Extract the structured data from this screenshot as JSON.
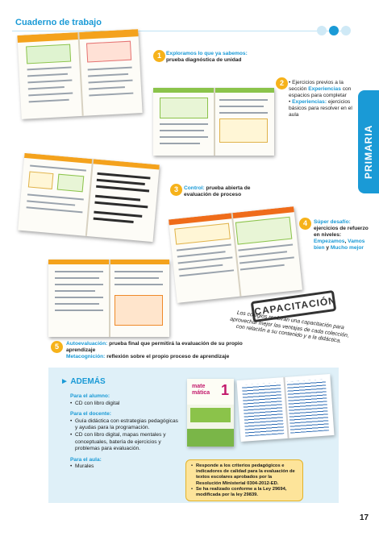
{
  "header": {
    "title": "Cuaderno de trabajo"
  },
  "side_tab": {
    "label": "PRIMARIA"
  },
  "colors": {
    "accent": "#1a9ad6",
    "number_badge": "#f6b21a"
  },
  "features": [
    {
      "number": "1",
      "label": "Exploramos lo que ya sabemos:",
      "text": "prueba diagnóstica de unidad"
    },
    {
      "number": "2",
      "items": [
        {
          "pre": "Ejercicios previos a la sección ",
          "highlight": "Experiencias",
          "post": " con espacios para completar"
        },
        {
          "pre": "",
          "highlight": "Experiencias:",
          "post": " ejercicios básicos para resolver en el aula"
        }
      ]
    },
    {
      "number": "3",
      "label": "Control:",
      "text": " prueba abierta de evaluación de proceso"
    },
    {
      "number": "4",
      "label": "Súper desafío:",
      "text": " ejercicios de refuerzo en niveles:",
      "levels": [
        "Empezamos",
        "Vamos bien",
        "Mucho mejor"
      ],
      "sep1": ", ",
      "sep2": " y "
    },
    {
      "number": "5",
      "line1_label": "Autoevaluación:",
      "line1_text": " prueba final que permitirá la evaluación de su propio aprendizaje",
      "line2_label": "Metacognición:",
      "line2_text": " reflexión sobre el propio proceso de aprendizaje"
    }
  ],
  "capacitacion": {
    "stamp": "CAPACITACIÓN",
    "text": "Los colegios recibirán una capacitación para aprovechar mejor las ventajas de cada colección, con relación a su contenido y a la didáctica."
  },
  "ademas": {
    "title": "ADEMÁS",
    "groups": [
      {
        "heading": "Para el alumno:",
        "items": [
          "CD con libro digital"
        ]
      },
      {
        "heading": "Para el docente:",
        "items": [
          "Guía didáctica con estrategias pedagógicas y ayudas para la programación.",
          "CD con libro digital, mapas mentales y conceptuales, batería de ejercicios y problemas para evaluación."
        ]
      },
      {
        "heading": "Para el aula:",
        "items": [
          "Murales"
        ]
      }
    ]
  },
  "cover": {
    "brand_line1": "mate",
    "brand_line2": "mática",
    "number": "1"
  },
  "compliance": [
    "Responde a los criterios pedagógicos e indicadores de calidad para la evaluación de textos escolares aprobados por la Resolución Ministerial 0304-2012-ED.",
    "Se ha realizado conforme a la Ley 29694, modificada por la ley 29839."
  ],
  "page_number": "17"
}
